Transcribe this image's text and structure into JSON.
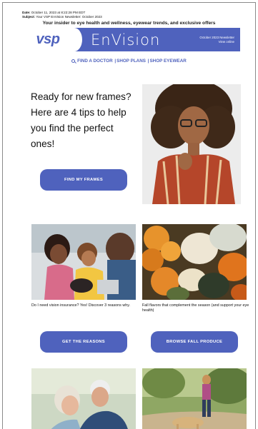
{
  "meta": {
    "date_label": "Date:",
    "date_value": "October 11, 2023 at 8:22:28 PM EDT",
    "subject_label": "Subject:",
    "subject_value": "Your VSP EnVision Newsletter: October 2023"
  },
  "tagline": "Your insider to eye health and wellness, eyewear trends, and exclusive offers",
  "banner": {
    "logo": "vsp",
    "logo_mark": "®",
    "brand": "EnVision",
    "issue_title": "October 2023 Newsletter",
    "view_online": "View online",
    "color": "#4f62bd"
  },
  "nav": {
    "items": [
      "FIND A DOCTOR",
      "SHOP PLANS",
      "SHOP EYEWEAR"
    ],
    "separator": "|",
    "icon": "search-icon"
  },
  "hero": {
    "headline": "Ready for new frames? Here are 4 tips to help you find the perfect ones!",
    "button": "FIND MY FRAMES"
  },
  "cards": [
    {
      "caption": "Do I need vision insurance? Yes! Discover 3 reasons why.",
      "button": "GET THE REASONS"
    },
    {
      "caption": "Fall flavors that complement the season (and support your eye health)",
      "button": "BROWSE FALL PRODUCE"
    }
  ]
}
